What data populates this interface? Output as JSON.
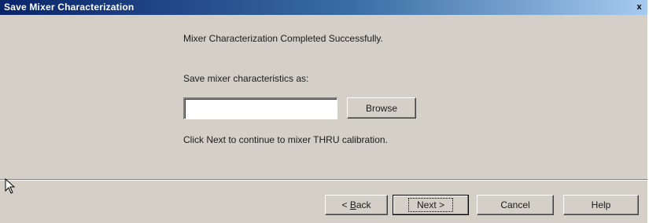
{
  "window": {
    "title": "Save Mixer Characterization",
    "close_glyph": "x"
  },
  "content": {
    "completed_message": "Mixer Characterization Completed Successfully.",
    "save_as_label": "Save mixer characteristics as:",
    "file_input": {
      "value": "",
      "placeholder": ""
    },
    "browse_label": "Browse",
    "next_instruction": "Click Next to continue to mixer THRU calibration."
  },
  "buttons": {
    "back_prefix": "< ",
    "back_accel": "B",
    "back_rest": "ack",
    "next_label": "Next >",
    "cancel_label": "Cancel",
    "help_label": "Help"
  },
  "icons": {
    "close": "close-icon",
    "cursor": "mouse-pointer-icon"
  },
  "colors": {
    "dialog_face": "#d4d0c8",
    "titlebar_start": "#0a246a",
    "titlebar_end": "#a6caf0",
    "title_text": "#ffffff"
  }
}
